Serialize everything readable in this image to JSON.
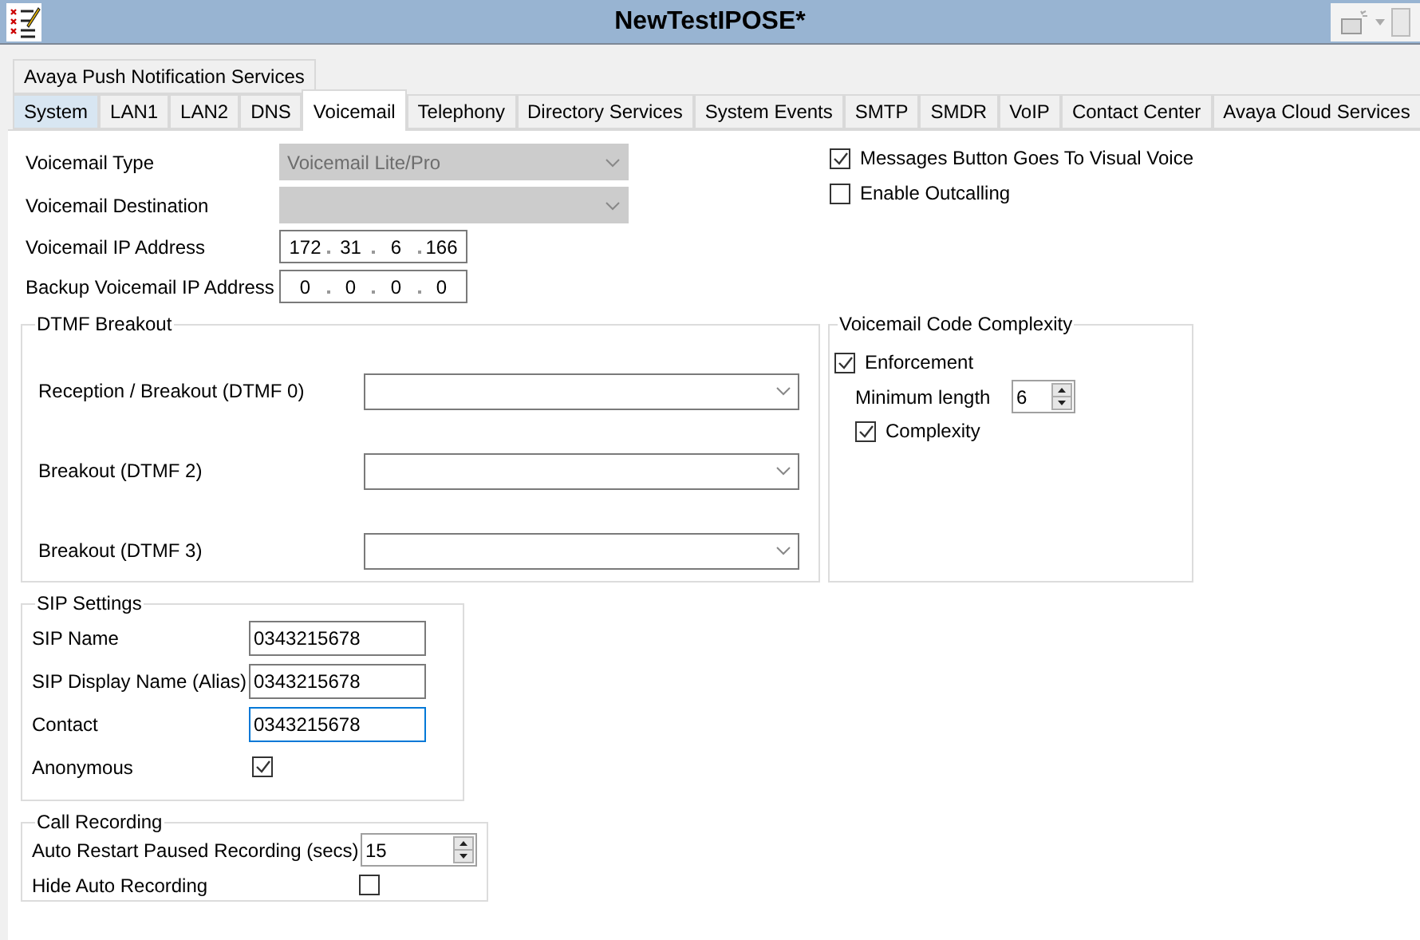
{
  "window": {
    "title": "NewTestIPOSE*"
  },
  "tabs_row1": [
    {
      "label": "Avaya Push Notification Services",
      "selected": false,
      "hot": false
    }
  ],
  "tabs_row2": [
    {
      "label": "System",
      "selected": false,
      "hot": true
    },
    {
      "label": "LAN1",
      "selected": false,
      "hot": false
    },
    {
      "label": "LAN2",
      "selected": false,
      "hot": false
    },
    {
      "label": "DNS",
      "selected": false,
      "hot": false
    },
    {
      "label": "Voicemail",
      "selected": true,
      "hot": false
    },
    {
      "label": "Telephony",
      "selected": false,
      "hot": false
    },
    {
      "label": "Directory Services",
      "selected": false,
      "hot": false
    },
    {
      "label": "System Events",
      "selected": false,
      "hot": false
    },
    {
      "label": "SMTP",
      "selected": false,
      "hot": false
    },
    {
      "label": "SMDR",
      "selected": false,
      "hot": false
    },
    {
      "label": "VoIP",
      "selected": false,
      "hot": false
    },
    {
      "label": "Contact Center",
      "selected": false,
      "hot": false
    },
    {
      "label": "Avaya Cloud Services",
      "selected": false,
      "hot": false
    }
  ],
  "voicemail_fields": [
    {
      "kind": "combo",
      "label": "Voicemail Type",
      "value": "Voicemail Lite/Pro",
      "disabled": true
    },
    {
      "kind": "combo",
      "label": "Voicemail Destination",
      "disabled": true
    },
    {
      "kind": "ip",
      "label": "Voicemail IP Address",
      "octets": [
        "172",
        "31",
        "6",
        "166"
      ]
    },
    {
      "kind": "ip",
      "label": "Backup Voicemail IP Address",
      "octets": [
        "0",
        "0",
        "0",
        "0"
      ]
    }
  ],
  "options": [
    {
      "label": "Messages Button Goes To Visual Voice",
      "checked": true
    },
    {
      "label": "Enable Outcalling",
      "checked": false
    }
  ],
  "dtmf_breakout": {
    "title": "DTMF Breakout",
    "rows": [
      {
        "label": "Reception / Breakout (DTMF 0)"
      },
      {
        "label": "Breakout (DTMF 2)"
      },
      {
        "label": "Breakout (DTMF 3)"
      }
    ]
  },
  "code_complexity": {
    "title": "Voicemail Code Complexity",
    "enforcement": {
      "label": "Enforcement",
      "checked": true
    },
    "minimum_length": {
      "label": "Minimum length",
      "value": "6"
    },
    "complexity": {
      "label": "Complexity",
      "checked": true
    }
  },
  "sip_settings": {
    "title": "SIP Settings",
    "fields": [
      {
        "label": "SIP Name",
        "value": "0343215678",
        "focused": false
      },
      {
        "label": "SIP Display Name (Alias)",
        "value": "0343215678",
        "focused": false
      },
      {
        "label": "Contact",
        "value": "0343215678",
        "focused": true
      }
    ],
    "anonymous": {
      "label": "Anonymous",
      "checked": true
    }
  },
  "call_recording": {
    "title": "Call Recording",
    "auto_restart": {
      "label": "Auto Restart Paused Recording (secs)",
      "value": "15"
    },
    "hide_auto_recording": {
      "label": "Hide Auto Recording",
      "checked": false
    }
  }
}
